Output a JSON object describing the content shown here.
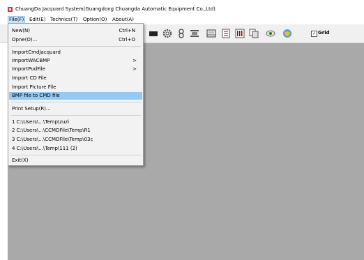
{
  "window": {
    "title": "ChuangDa Jacquard System(Guangdong Chuangda Automatic Equipment Co.,Ltd)"
  },
  "menubar": [
    "File(F)",
    "Edit(E)",
    "Technics(T)",
    "Option(O)",
    "About(A)"
  ],
  "toolbar": {
    "icons": [
      "black-bar-icon",
      "gear-icon",
      "ring-stack-icon",
      "spool-icon",
      "loom-icon",
      "list-icon",
      "barcode-icon",
      "copy-icon",
      "eye-icon",
      "globe-icon"
    ],
    "grid_checked": true,
    "grid_check_glyph": "✓",
    "grid_label": "Grid"
  },
  "file_menu": {
    "group1": [
      {
        "label": "New(N)",
        "shortcut": "Ctrl+N"
      },
      {
        "label": "Opne(O)...",
        "shortcut": "Ctrl+O"
      }
    ],
    "group2": [
      {
        "label": "ImportCmdJacquard"
      },
      {
        "label": "ImportWACBMP",
        "submenu": ">"
      },
      {
        "label": "ImportPudFile",
        "submenu": ">"
      },
      {
        "label": "Import CD File"
      },
      {
        "label": "Import Picture File"
      },
      {
        "label": "BMP file to CMD file",
        "highlighted": true
      }
    ],
    "group3": [
      {
        "label": "Print Setup(R)..."
      }
    ],
    "recent": [
      "1 C:\\Users\\...\\Temp\\zuzi",
      "2 C:\\Users\\...\\CCMDFile\\Temp\\R1",
      "3 C:\\Users\\...\\CCMDFile\\Temp\\03c",
      "4 C:\\Users\\...\\Temp\\111 (2)"
    ],
    "exit": "Exit(X)"
  },
  "colors": {
    "workspace": "#a9a9a9",
    "highlight": "#91c9f7",
    "active_menu": "#cce4f7",
    "app_icon": "#d9372b"
  }
}
